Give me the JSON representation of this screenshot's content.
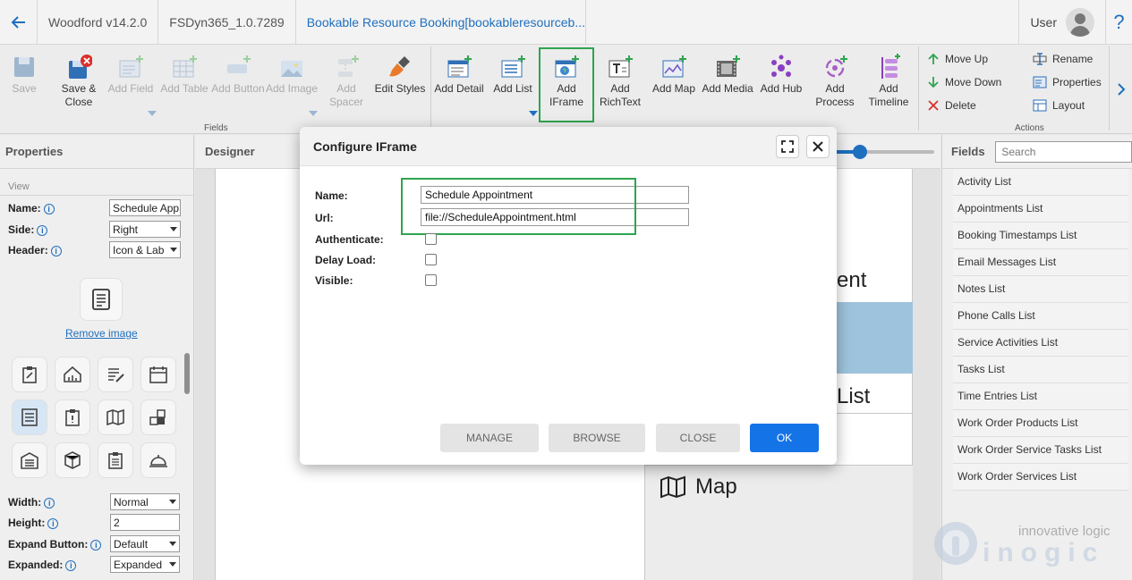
{
  "titlebar": {
    "app": "Woodford v14.2.0",
    "project": "FSDyn365_1.0.7289",
    "entity": "Bookable Resource Booking[bookableresourceb...",
    "user": "User",
    "help": "?"
  },
  "ribbon": {
    "buttons": [
      {
        "label": "Save",
        "enabled": false
      },
      {
        "label": "Save & Close",
        "enabled": true
      },
      {
        "label": "Add Field",
        "enabled": false
      },
      {
        "label": "Add Table",
        "enabled": false
      },
      {
        "label": "Add Button",
        "enabled": false
      },
      {
        "label": "Add Image",
        "enabled": false
      },
      {
        "label": "Add Spacer",
        "enabled": false
      },
      {
        "label": "Edit Styles",
        "enabled": true
      },
      {
        "label": "Add Detail",
        "enabled": true
      },
      {
        "label": "Add List",
        "enabled": true
      },
      {
        "label": "Add IFrame",
        "enabled": true
      },
      {
        "label": "Add RichText",
        "enabled": true
      },
      {
        "label": "Add Map",
        "enabled": true
      },
      {
        "label": "Add Media",
        "enabled": true
      },
      {
        "label": "Add Hub",
        "enabled": true
      },
      {
        "label": "Add Process",
        "enabled": true
      },
      {
        "label": "Add Timeline",
        "enabled": true
      }
    ],
    "group_fields": "Fields",
    "group_actions": "Actions",
    "actions": {
      "move_up": "Move Up",
      "move_down": "Move Down",
      "delete": "Delete",
      "rename": "Rename",
      "properties": "Properties",
      "layout": "Layout"
    }
  },
  "properties": {
    "title": "Properties",
    "section": "View",
    "name_label": "Name:",
    "name_value": "Schedule App",
    "side_label": "Side:",
    "side_value": "Right",
    "header_label": "Header:",
    "header_value": "Icon & Lab",
    "remove_image": "Remove image",
    "width_label": "Width:",
    "width_value": "Normal",
    "height_label": "Height:",
    "height_value": "2",
    "expand_button_label": "Expand Button:",
    "expand_button_value": "Default",
    "expanded_label": "Expanded:",
    "expanded_value": "Expanded"
  },
  "designer": {
    "title": "Designer",
    "canvas_text_1": "ent",
    "canvas_text_2": "List",
    "canvas_map": "Map"
  },
  "fields": {
    "title": "Fields",
    "search_placeholder": "Search",
    "items": [
      "Activity List",
      "Appointments List",
      "Booking Timestamps List",
      "Email Messages List",
      "Notes List",
      "Phone Calls List",
      "Service Activities List",
      "Tasks List",
      "Time Entries List",
      "Work Order Products List",
      "Work Order Service Tasks List",
      "Work Order Services List"
    ]
  },
  "modal": {
    "title": "Configure IFrame",
    "name_label": "Name:",
    "name_value": "Schedule Appointment",
    "url_label": "Url:",
    "url_value": "file://ScheduleAppointment.html",
    "authenticate_label": "Authenticate:",
    "delay_load_label": "Delay Load:",
    "visible_label": "Visible:",
    "authenticate": false,
    "delay_load": false,
    "visible": false,
    "manage": "MANAGE",
    "browse": "BROWSE",
    "close": "CLOSE",
    "ok": "OK"
  },
  "watermark": {
    "tagline": "innovative logic",
    "brand": "inogic"
  },
  "colors": {
    "accent": "#1473e6",
    "link": "#1f6fbf",
    "highlight": "#2ea44f"
  }
}
